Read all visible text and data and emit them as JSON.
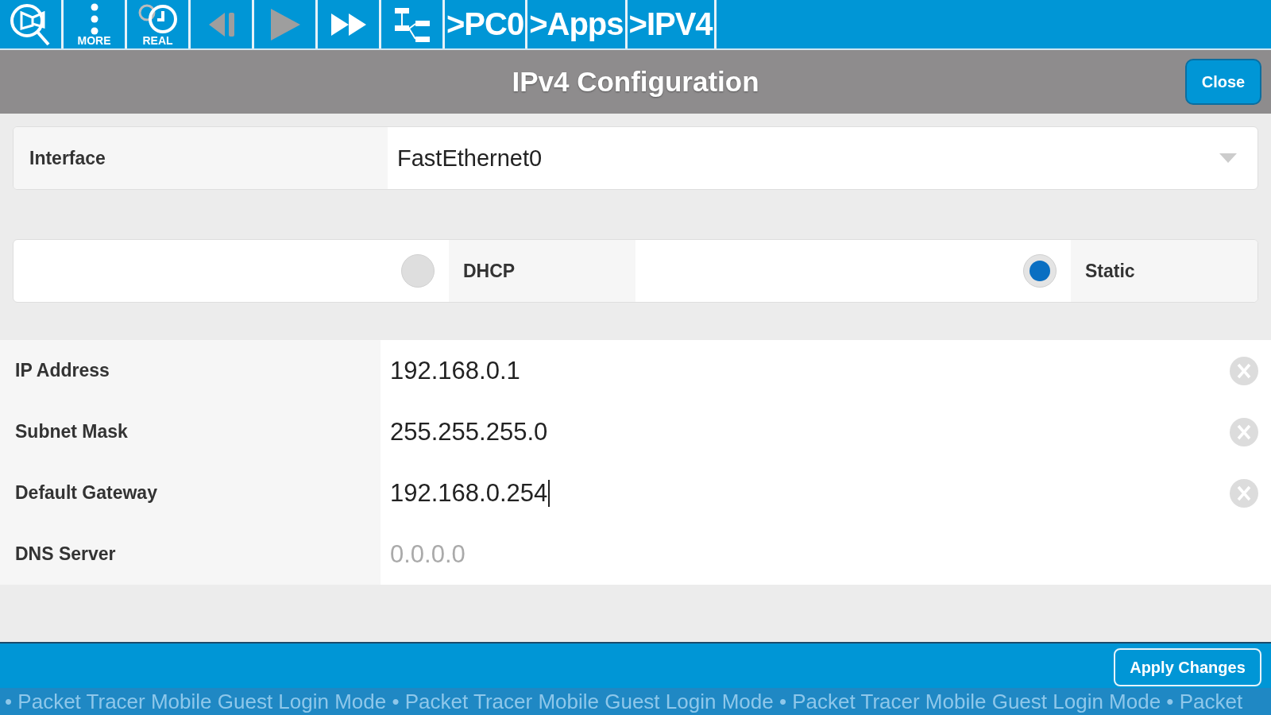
{
  "toolbar": {
    "tools": [
      {
        "kind": "inspect",
        "disabled": false
      },
      {
        "kind": "more",
        "label": "MORE",
        "disabled": false
      },
      {
        "kind": "realtime",
        "label": "REAL",
        "disabled": false
      },
      {
        "kind": "step-back",
        "disabled": true
      },
      {
        "kind": "play",
        "disabled": true
      },
      {
        "kind": "fast-forward",
        "disabled": false
      },
      {
        "kind": "topology",
        "disabled": false
      }
    ],
    "breadcrumbs": [
      ">PC0",
      ">Apps",
      ">IPV4"
    ]
  },
  "header": {
    "title": "IPv4 Configuration",
    "close_button": "Close"
  },
  "interface": {
    "label": "Interface",
    "value": "FastEthernet0"
  },
  "modes": [
    {
      "label": "DHCP",
      "selected": false
    },
    {
      "label": "Static",
      "selected": true
    }
  ],
  "fields": [
    {
      "label": "IP Address",
      "value": "192.168.0.1",
      "focused": false
    },
    {
      "label": "Subnet Mask",
      "value": "255.255.255.0",
      "focused": false
    },
    {
      "label": "Default Gateway",
      "value": "192.168.0.254",
      "focused": true
    },
    {
      "label": "DNS Server",
      "placeholder": "0.0.0.0",
      "focused": false
    }
  ],
  "footer": {
    "apply_button": "Apply Changes",
    "ticker": "• Packet Tracer Mobile Guest Login Mode • Packet Tracer Mobile Guest Login Mode • Packet Tracer Mobile Guest Login Mode • Packet"
  }
}
